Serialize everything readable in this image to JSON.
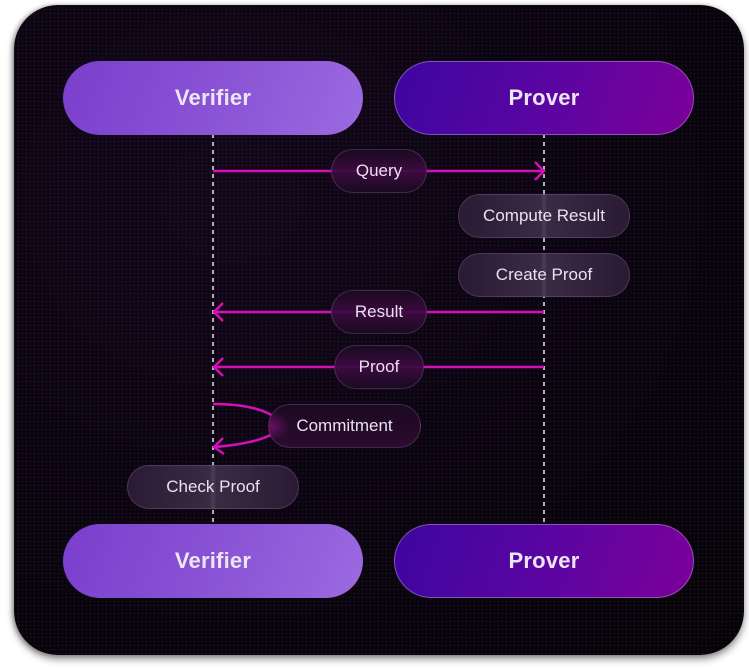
{
  "diagram": {
    "type": "sequence",
    "colors": {
      "verifier": "#8b55d6",
      "prover": "#5a05a2",
      "message_arrow": "#d40fb8",
      "lifeline": "#d8d8d8",
      "background": "#0a0310"
    },
    "participants": {
      "verifier_top": "Verifier",
      "prover_top": "Prover",
      "verifier_bottom": "Verifier",
      "prover_bottom": "Prover"
    },
    "messages": [
      {
        "label": "Query",
        "from": "Verifier",
        "to": "Prover"
      },
      {
        "label": "Result",
        "from": "Prover",
        "to": "Verifier"
      },
      {
        "label": "Proof",
        "from": "Prover",
        "to": "Verifier"
      },
      {
        "label": "Commitment",
        "from": "Verifier",
        "to": "Verifier"
      }
    ],
    "actions": [
      {
        "label": "Compute Result",
        "actor": "Prover"
      },
      {
        "label": "Create Proof",
        "actor": "Prover"
      },
      {
        "label": "Check Proof",
        "actor": "Verifier"
      }
    ]
  }
}
